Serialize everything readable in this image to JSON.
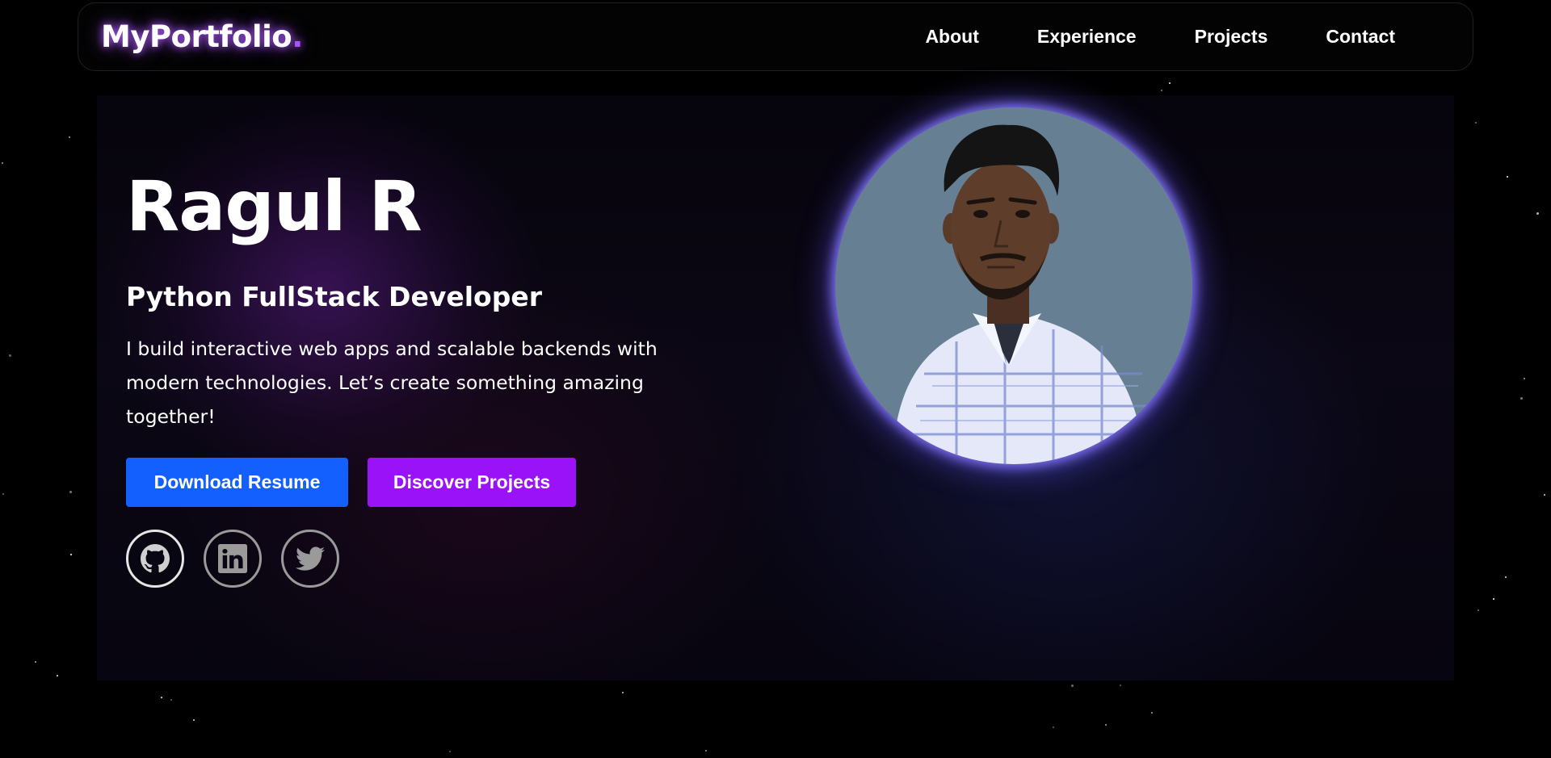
{
  "brand": {
    "name": "MyPortfolio",
    "dot": "."
  },
  "nav": {
    "items": [
      "About",
      "Experience",
      "Projects",
      "Contact"
    ]
  },
  "hero": {
    "name": "Ragul R",
    "role": "Python FullStack Developer",
    "description": "I build interactive web apps and scalable backends with modern technologies. Let’s create something amazing together!",
    "buttons": {
      "resume": "Download Resume",
      "projects": "Discover Projects"
    },
    "socials": [
      "github-icon",
      "linkedin-icon",
      "twitter-icon"
    ]
  },
  "colors": {
    "accent_purple": "#a855f7",
    "button_blue": "#1460ff",
    "button_purple": "#9a12f7",
    "background": "#000000"
  }
}
